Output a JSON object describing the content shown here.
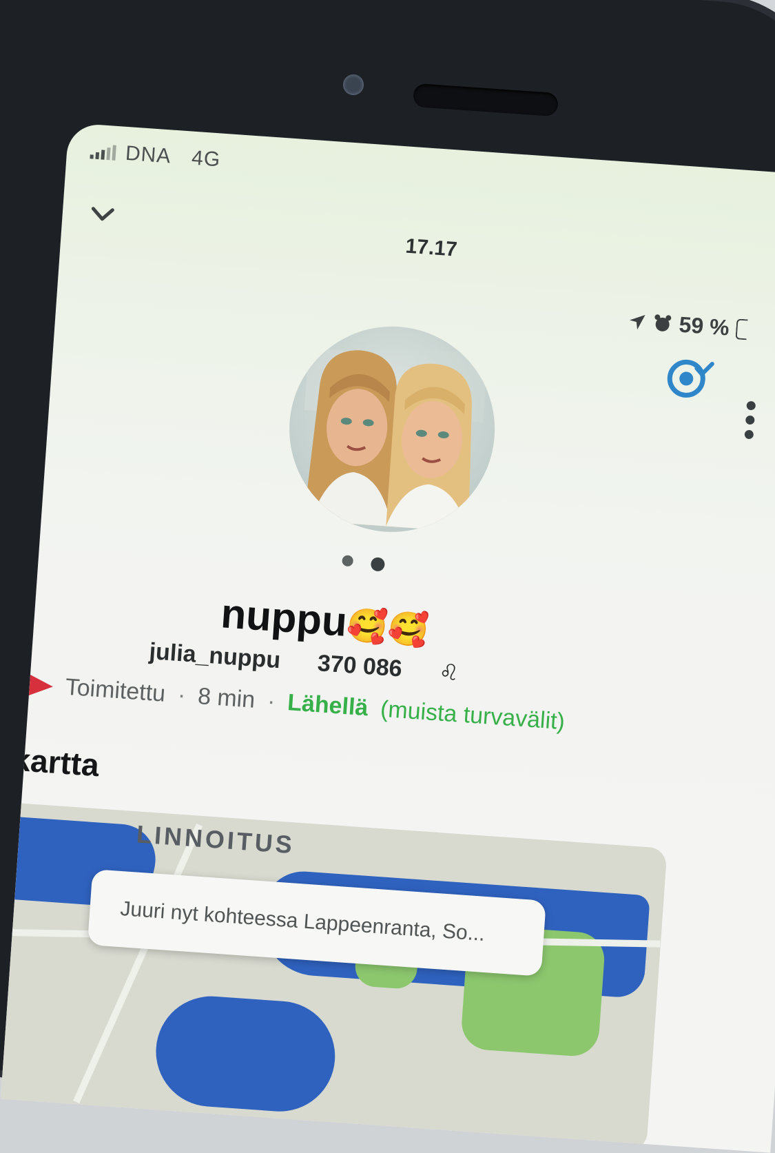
{
  "status_bar": {
    "carrier": "DNA",
    "network": "4G",
    "time": "17.17",
    "battery": "59 %"
  },
  "profile": {
    "display_name": "nuppu",
    "display_emoji": "🥰🥰",
    "username": "julia_nuppu",
    "score": "370 086",
    "zodiac_symbol": "♌",
    "delivery_status": "Toimitettu",
    "delivery_time": "8 min",
    "proximity": "Lähellä",
    "proximity_note": "(muista turvavälit)"
  },
  "map_section": {
    "title": "p-kartta",
    "area_label": "LINNOITUS",
    "location_text": "Juuri nyt kohteessa Lappeenranta, So..."
  },
  "colors": {
    "accent_blue": "#2f86c8",
    "nearby_green": "#37b04a",
    "sent_red": "#d7303d",
    "map_water": "#2f62bf"
  }
}
